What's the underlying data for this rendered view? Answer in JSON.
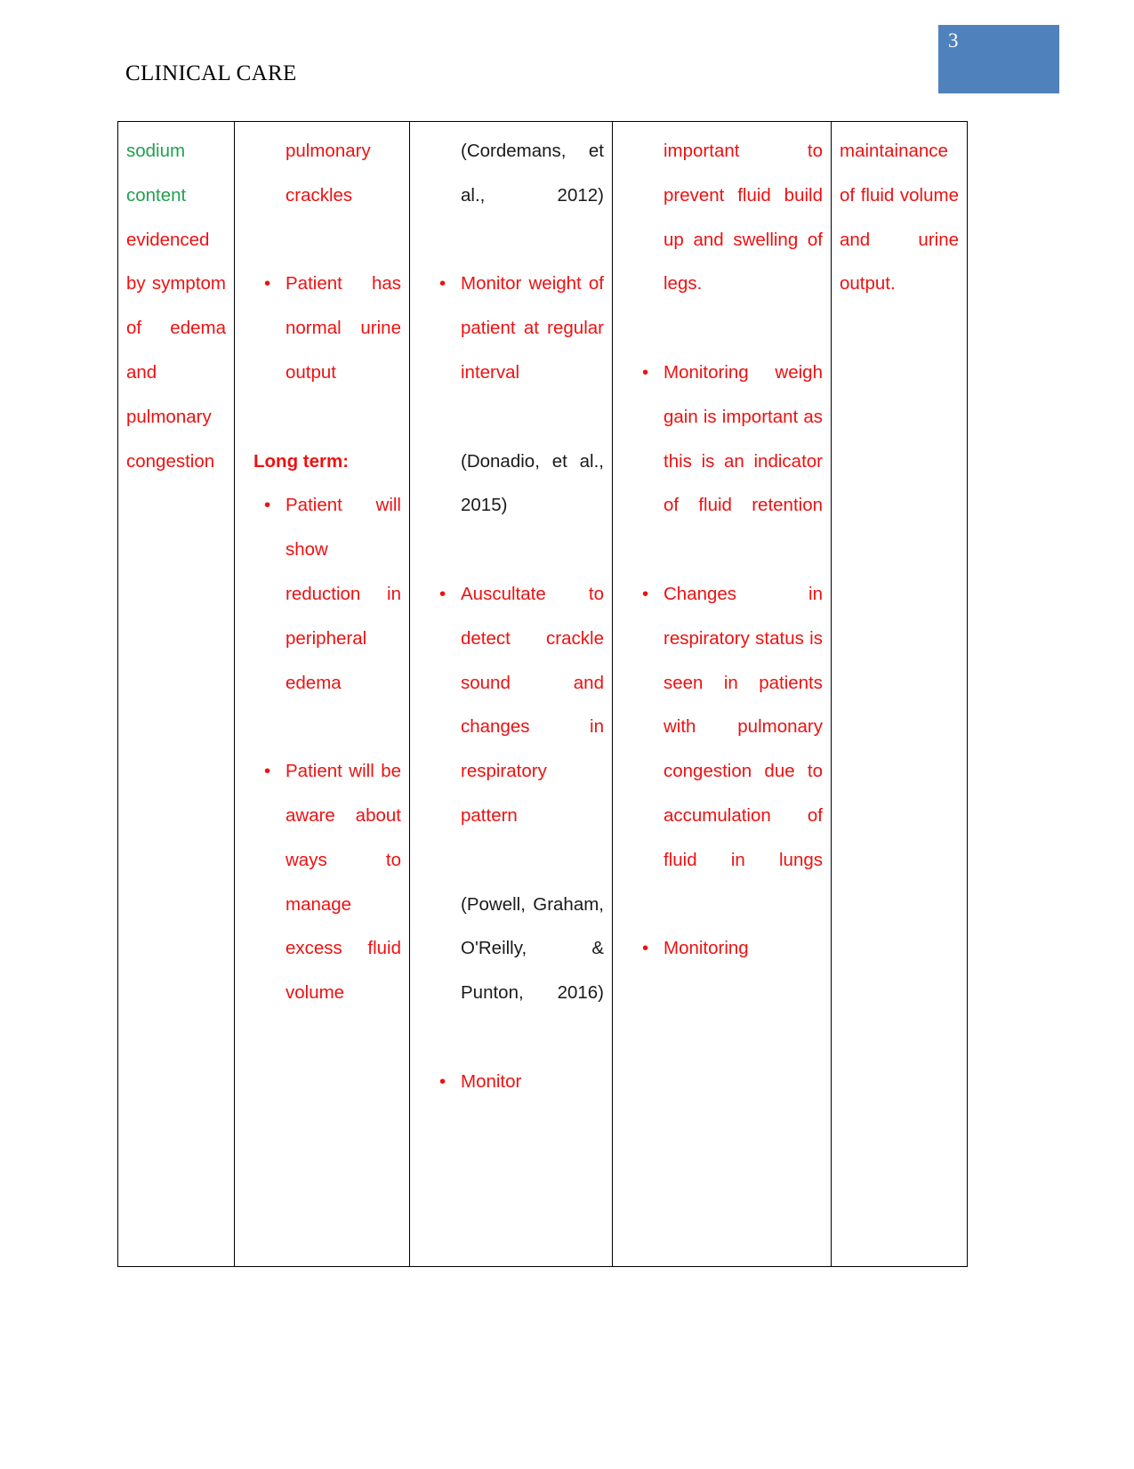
{
  "page": {
    "number": "3",
    "header_title": "CLINICAL CARE",
    "accent_color": "#4f81bd",
    "text_red": "#ee1111",
    "text_green": "#21a04e",
    "text_black": "#1a1a1a"
  },
  "table": {
    "columns": [
      {
        "name": "assessment-column",
        "blocks": [
          {
            "kind": "paragraph",
            "color": "mixed",
            "green_text": "sodium content",
            "red_text": " evidenced by symptom of edema and pulmonary congestion"
          }
        ]
      },
      {
        "name": "goals-column",
        "continuation": "pulmonary crackles",
        "bullets_short": [
          "Patient has normal urine output"
        ],
        "long_term_label": "Long term:",
        "bullets_long": [
          "Patient will show reduction in peripheral edema",
          "Patient will be aware about ways to manage excess fluid volume"
        ]
      },
      {
        "name": "interventions-column",
        "citation_1": "(Cordemans, et al., 2012)",
        "bullet_1": "Monitor weight of patient at regular interval",
        "citation_2": "(Donadio, et al., 2015)",
        "bullet_2": "Auscultate to detect crackle sound and changes in respiratory pattern",
        "citation_3": "(Powell, Graham, O'Reilly, & Punton, 2016)",
        "bullet_3": "Monitor"
      },
      {
        "name": "rationale-column",
        "continuation": "important to prevent fluid build up and swelling of legs.",
        "bullets": [
          "Monitoring weigh gain is important as this is an indicator of fluid retention",
          "Changes in respiratory status is seen in patients with pulmonary congestion due to accumulation of fluid in lungs",
          "Monitoring"
        ]
      },
      {
        "name": "evaluation-column",
        "text": "maintainance of fluid volume and urine output."
      }
    ]
  }
}
